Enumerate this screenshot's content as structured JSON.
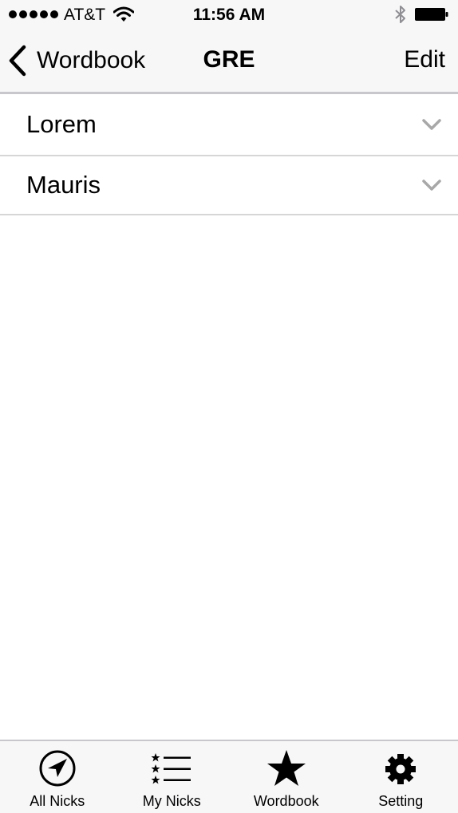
{
  "status_bar": {
    "carrier": "AT&T",
    "time": "11:56 AM",
    "signal_icon": "signal-dots-icon",
    "wifi_icon": "wifi-icon",
    "bluetooth_icon": "bluetooth-icon",
    "battery_icon": "battery-icon",
    "battery_level": 1.0
  },
  "nav": {
    "back_label": "Wordbook",
    "back_icon": "chevron-left-icon",
    "title": "GRE",
    "edit_label": "Edit"
  },
  "list": {
    "items": [
      {
        "label": "Lorem",
        "icon": "chevron-down-icon"
      },
      {
        "label": "Mauris",
        "icon": "chevron-down-icon"
      }
    ]
  },
  "tabs": {
    "items": [
      {
        "label": "All Nicks",
        "icon": "location-arrow-icon"
      },
      {
        "label": "My Nicks",
        "icon": "starred-list-icon"
      },
      {
        "label": "Wordbook",
        "icon": "star-icon"
      },
      {
        "label": "Setting",
        "icon": "gear-icon"
      }
    ]
  },
  "colors": {
    "bar_background": "#f7f7f8",
    "separator": "#d6d6d6",
    "chevron": "#a8a8a8",
    "text": "#000000"
  }
}
